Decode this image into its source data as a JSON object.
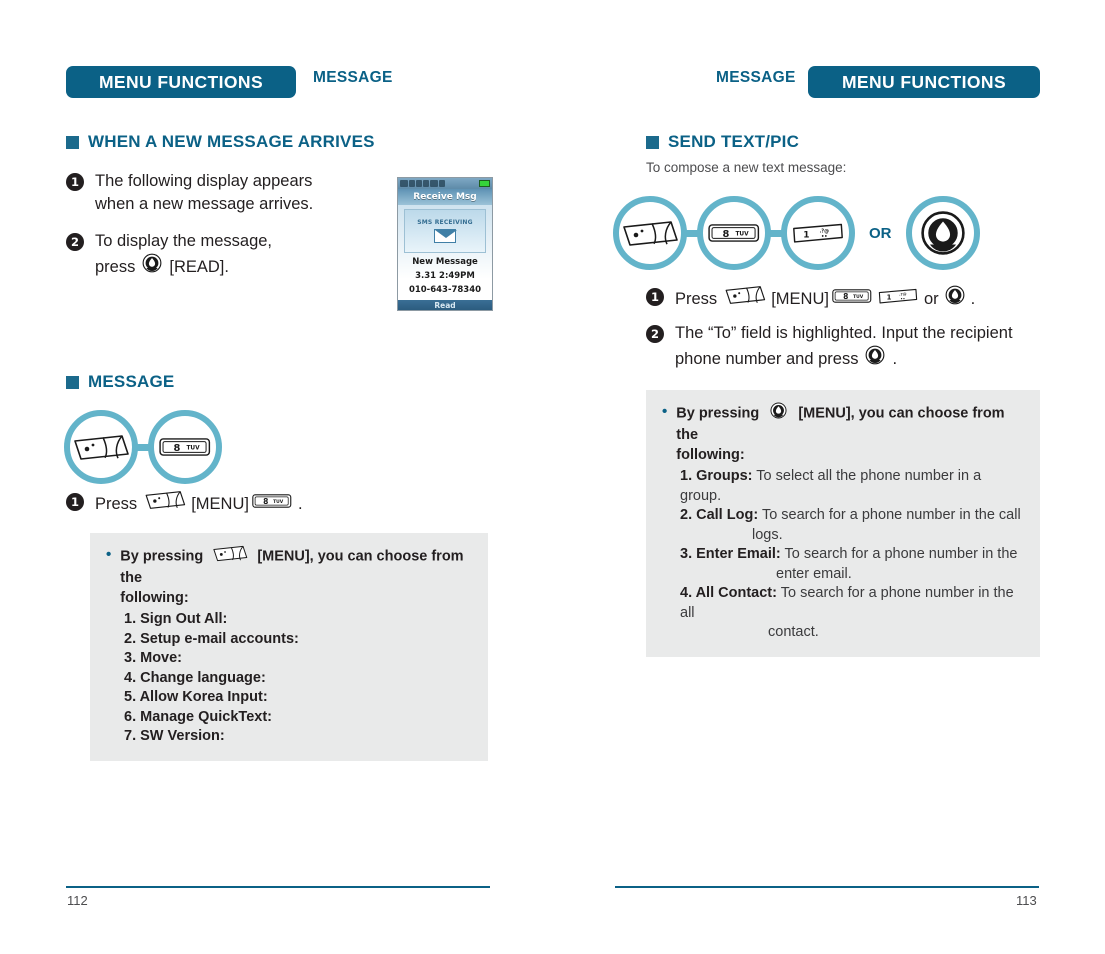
{
  "left_page": {
    "header": {
      "badge": "MENU FUNCTIONS",
      "subtitle": "MESSAGE"
    },
    "section_when": {
      "title": "WHEN A NEW MESSAGE ARRIVES"
    },
    "steps": [
      {
        "num": "1",
        "text": "The following display appears\nwhen a new message arrives."
      },
      {
        "num": "2",
        "pre": "To display the message,",
        "line2_pre": "press",
        "icon": "ok-center-key-icon",
        "line2_post": "[READ]."
      }
    ],
    "section_message": {
      "title": "MESSAGE"
    },
    "keyrow": [
      {
        "icon": "menu-softkey-icon",
        "label": "MENU"
      },
      {
        "icon": "key-8-tuv-icon",
        "label": "8 TUV"
      }
    ],
    "step_press": {
      "num": "1",
      "pre": "Press",
      "icon1": "menu-softkey-icon",
      "mid": "[MENU]",
      "icon2": "key-8-tuv-icon",
      "post": "."
    },
    "note": {
      "bullet": "•",
      "lead_pre": "By pressing",
      "lead_icon": "menu-softkey-icon",
      "lead_post": "[MENU], you can choose from the",
      "lead_cont": "following:",
      "items": [
        "1. Sign Out All:",
        "2. Setup e-mail accounts:",
        "3. Move:",
        "4. Change language:",
        "5. Allow Korea Input:",
        "6. Manage QuickText:",
        "7. SW Version:"
      ]
    },
    "phone": {
      "title": "Receive Msg",
      "card_label": "SMS RECEIVING",
      "envelope_icon": "envelope-icon",
      "line1": "New Message",
      "line2": "3.31  2:49PM",
      "line3": "010-643-78340",
      "softkey": "Read"
    },
    "footer": {
      "page_number": "112"
    }
  },
  "right_page": {
    "header": {
      "badge": "MENU FUNCTIONS",
      "subtitle": "MESSAGE"
    },
    "section_send": {
      "title": "SEND TEXT/PIC"
    },
    "caption": "To compose a new text message:",
    "keyrow": [
      {
        "icon": "menu-softkey-icon",
        "label": "MENU"
      },
      {
        "icon": "key-8-tuv-icon",
        "label": "8 TUV"
      },
      {
        "icon": "key-1-punct-icon",
        "label": "1 .?@"
      }
    ],
    "or_label": "OR",
    "or_key": {
      "icon": "ok-center-key-icon",
      "label": "OK"
    },
    "steps": [
      {
        "num": "1",
        "pre": "Press",
        "icon1": "menu-softkey-icon",
        "mid": "[MENU]",
        "icon2": "key-8-tuv-icon",
        "icon3": "key-1-punct-icon",
        "or": "or",
        "icon4": "ok-center-key-icon",
        "post": "."
      },
      {
        "num": "2",
        "text_line1": "The “To” field is highlighted. Input the recipient",
        "text_line2_pre": "phone number and press",
        "icon": "ok-center-key-icon",
        "text_line2_post": "."
      }
    ],
    "note": {
      "bullet": "•",
      "lead_pre": "By pressing",
      "lead_icon": "ok-center-key-icon",
      "lead_post": "[MENU], you can choose from the",
      "lead_cont": "following:",
      "items": [
        {
          "label": "1. Groups:",
          "desc": "To select all the phone number in a group.",
          "desc2": ""
        },
        {
          "label": "2. Call Log:",
          "desc": "To search for a phone number in the call",
          "desc2": "logs."
        },
        {
          "label": "3. Enter Email:",
          "desc": "To search for a phone number in the",
          "desc2": "enter email."
        },
        {
          "label": "4. All Contact:",
          "desc": "To search for a phone number in the all",
          "desc2": "contact."
        }
      ]
    },
    "footer": {
      "page_number": "113"
    }
  },
  "theme": {
    "accent_dark": "#0b6186",
    "accent_light": "#63b4ca",
    "note_bg": "#e9eaea",
    "text": "#231f20"
  }
}
